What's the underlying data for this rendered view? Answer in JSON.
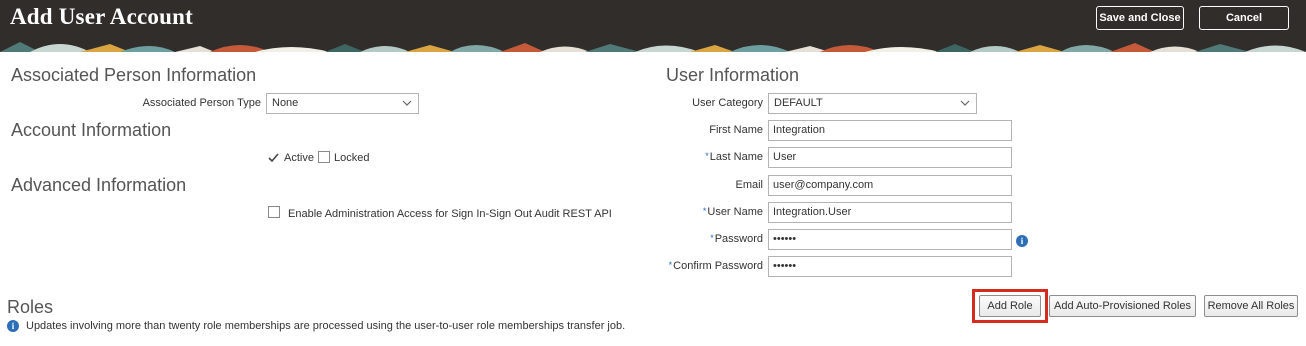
{
  "header": {
    "title": "Add User Account",
    "save_label": "Save and Close",
    "cancel_label": "Cancel",
    "background_color": "#312d2a"
  },
  "associated_person": {
    "section_title": "Associated Person Information",
    "type_label": "Associated Person Type",
    "type_value": "None"
  },
  "account": {
    "section_title": "Account Information",
    "active_label": "Active",
    "active_checked": true,
    "locked_label": "Locked",
    "locked_checked": false
  },
  "advanced": {
    "section_title": "Advanced Information",
    "audit_label": "Enable Administration Access for Sign In-Sign Out Audit REST API",
    "audit_checked": false
  },
  "user_info": {
    "section_title": "User Information",
    "required_marker": "*",
    "category_label": "User Category",
    "category_value": "DEFAULT",
    "first_name_label": "First Name",
    "first_name_value": "Integration",
    "last_name_label": "Last Name",
    "last_name_value": "User",
    "email_label": "Email",
    "email_value": "user@company.com",
    "username_label": "User Name",
    "username_value": "Integration.User",
    "password_label": "Password",
    "password_value": "••••••",
    "confirm_password_label": "Confirm Password",
    "confirm_password_value": "••••••"
  },
  "roles": {
    "section_title": "Roles",
    "add_role_label": "Add Role",
    "add_auto_label": "Add Auto-Provisioned Roles",
    "remove_all_label": "Remove All Roles",
    "info_note": "Updates involving more than twenty role memberships are processed using the user-to-user role memberships transfer job."
  },
  "icons": {
    "info": "info-icon",
    "chevron": "chevron-down-icon",
    "check": "checkmark-icon"
  },
  "colors": {
    "accent": "#2d6fb7",
    "highlight": "#d52b1e"
  }
}
